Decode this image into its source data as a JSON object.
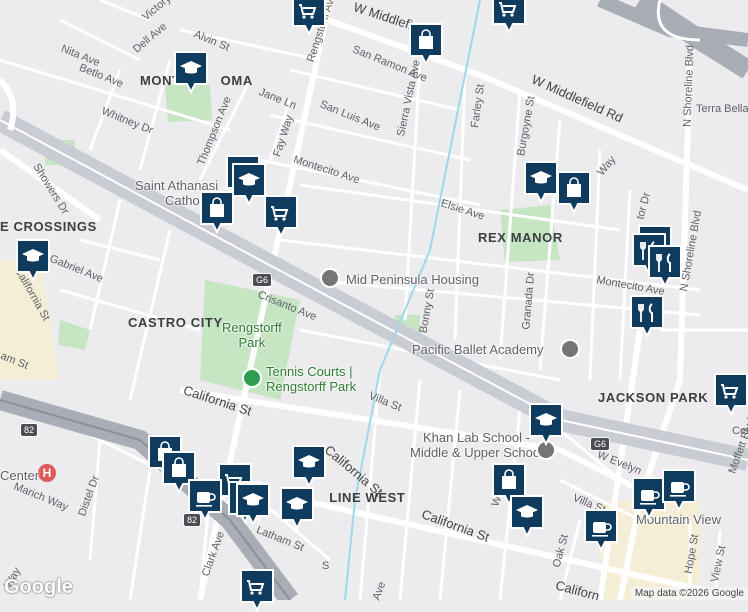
{
  "colors": {
    "background": "#ecebee",
    "road": "#ffffff",
    "major_road": "#c9ccd3",
    "freeway": "#a9adb5",
    "park": "#c6e5c3",
    "marker_fill": "#0f3b5f",
    "water": "#9fd8e8",
    "commercial": "#f5eed6"
  },
  "streets": {
    "rengstorff_ave": "Rengstorff Ave",
    "w_middlefield": "W Middlefield",
    "w_middlefield_rd": "W Middlefield Rd",
    "san_ramon_ave": "San Ramon Ave",
    "san_luis_ave": "San Luis Ave",
    "jane_ln": "Jane Ln",
    "fay_way": "Fay Way",
    "thompson_ave": "Thompson Ave",
    "whitney_dr": "Whitney Dr",
    "betlo_ave": "Betlo Ave",
    "nita_ave": "Nita Ave",
    "dell_ave": "Dell Ave",
    "alvin_st": "Alvin St",
    "victory": "Victory",
    "montecito_ave": "Montecito Ave",
    "montecito_ave_e": "Montecito Ave",
    "elsie_ave": "Elsie Ave",
    "sierra_vista_ave": "Sierra Vista Ave",
    "farley_st": "Farley St",
    "burgoyne_st": "Burgoyne St",
    "terra_bella": "Terra Bella",
    "n_shoreline_blvd": "N Shoreline Blvd",
    "crisanto_ave": "Crisanto Ave",
    "bonny_st": "Bonny St",
    "granada_dr": "Granada Dr",
    "california_st_1": "California St",
    "california_st_2": "California St",
    "california_st_3": "California St",
    "california_st_4": "California St",
    "california_st_5": "Californ",
    "villa_st": "Villa St",
    "villa_st_2": "Villa St",
    "showers_dr": "Showers Dr",
    "gabriel_ave": "Gabriel Ave",
    "am_st": "am St",
    "marich_way": "Marich Way",
    "distel_dr": "Distel Dr",
    "clark_ave": "Clark Ave",
    "latham_st": "Latham St",
    "oak_st": "Oak St",
    "hope_st": "Hope St",
    "view_st": "View St",
    "w_evelyn": "W Evelyn",
    "moffett_blvd": "Moffett Blvd",
    "ay": "Way",
    "w_d": "W D",
    "tor_dr": "tor Dr",
    "cen": "Cen",
    "ave_bottom": "Ave",
    "s_st": "S",
    "way_bottom": "Way"
  },
  "areas": {
    "monta_loma_a": "MONT",
    "monta_loma_b": "OMA",
    "crossings": "E CROSSINGS",
    "castro_city": "CASTRO CITY",
    "rex_manor": "REX MANOR",
    "jackson_park": "JACKSON PARK",
    "shoreline_west_a": "S",
    "shoreline_west_b": "LINE WEST"
  },
  "pois": {
    "saint_athanasius": "Saint Athanasi",
    "catholic": "Catholic",
    "mid_peninsula_housing": "Mid Peninsula Housing",
    "rengstorff_park": "Rengstorff\nPark",
    "tennis_courts": "Tennis Courts |\nRengstorff Park",
    "pacific_ballet": "Pacific Ballet Academy",
    "khan_lab_school": "Khan Lab School -\nMiddle & Upper School",
    "center": "Center",
    "mountain_view": "Mountain View"
  },
  "highway_shields": {
    "g6_west": "G6",
    "g6_east": "G6",
    "r82_a": "82",
    "r82_b": "82"
  },
  "markers": [
    {
      "icon": "grocery-icon"
    },
    {
      "icon": "grocery-icon"
    },
    {
      "icon": "shopping-bag-icon"
    },
    {
      "icon": "school-icon"
    },
    {
      "icon": "school-icon"
    },
    {
      "icon": "school-icon"
    },
    {
      "icon": "shopping-bag-icon"
    },
    {
      "icon": "shopping-bag-icon"
    },
    {
      "icon": "grocery-icon"
    },
    {
      "icon": "school-icon"
    },
    {
      "icon": "school-icon"
    },
    {
      "icon": "restaurant-icon"
    },
    {
      "icon": "restaurant-icon"
    },
    {
      "icon": "restaurant-icon"
    },
    {
      "icon": "grocery-icon"
    },
    {
      "icon": "school-icon"
    },
    {
      "icon": "restaurant-icon"
    },
    {
      "icon": "shopping-bag-icon"
    },
    {
      "icon": "shopping-bag-icon"
    },
    {
      "icon": "grocery-icon"
    },
    {
      "icon": "coffee-icon"
    },
    {
      "icon": "restaurant-icon"
    },
    {
      "icon": "school-icon"
    },
    {
      "icon": "school-icon"
    },
    {
      "icon": "school-icon"
    },
    {
      "icon": "shopping-bag-icon"
    },
    {
      "icon": "school-icon"
    },
    {
      "icon": "coffee-icon"
    },
    {
      "icon": "coffee-icon"
    },
    {
      "icon": "coffee-icon"
    },
    {
      "icon": "grocery-icon"
    }
  ],
  "branding": {
    "logo": "Google",
    "attribution": "Map data ©2026 Google"
  }
}
